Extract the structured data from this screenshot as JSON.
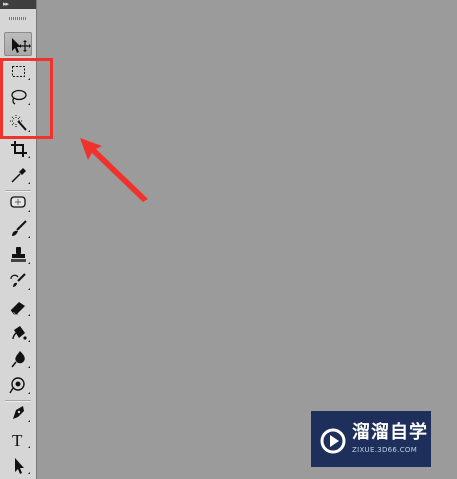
{
  "toolbar": {
    "collapse_label": "▸▸",
    "tools": [
      {
        "name": "move-tool",
        "icon": "move-arrow-icon",
        "active": true
      },
      {
        "name": "rectangular-marquee-tool",
        "icon": "rectangular-marquee-icon"
      },
      {
        "name": "lasso-tool",
        "icon": "lasso-icon"
      },
      {
        "name": "magic-wand-tool",
        "icon": "magic-wand-icon"
      },
      {
        "name": "crop-tool",
        "icon": "crop-icon"
      },
      {
        "name": "eyedropper-tool",
        "icon": "eyedropper-icon"
      },
      {
        "name": "spot-healing-brush-tool",
        "icon": "healing-bandage-icon"
      },
      {
        "name": "brush-tool",
        "icon": "brush-icon"
      },
      {
        "name": "clone-stamp-tool",
        "icon": "stamp-icon"
      },
      {
        "name": "history-brush-tool",
        "icon": "history-brush-icon"
      },
      {
        "name": "eraser-tool",
        "icon": "eraser-icon"
      },
      {
        "name": "paint-bucket-tool",
        "icon": "paint-bucket-icon"
      },
      {
        "name": "blur-tool",
        "icon": "blur-drop-icon"
      },
      {
        "name": "dodge-tool",
        "icon": "dodge-icon"
      },
      {
        "name": "pen-tool",
        "icon": "pen-icon"
      },
      {
        "name": "type-tool",
        "icon": "type-icon",
        "label": "T"
      },
      {
        "name": "path-selection-tool",
        "icon": "path-selection-arrow-icon"
      }
    ]
  },
  "annotation": {
    "color": "#f0322c",
    "target": "selection tools group"
  },
  "watermark": {
    "title": "溜溜自学",
    "url": "ZIXUE.3D66.COM",
    "background": "#1d2f5a"
  },
  "canvas": {
    "background": "#9b9b9b"
  }
}
